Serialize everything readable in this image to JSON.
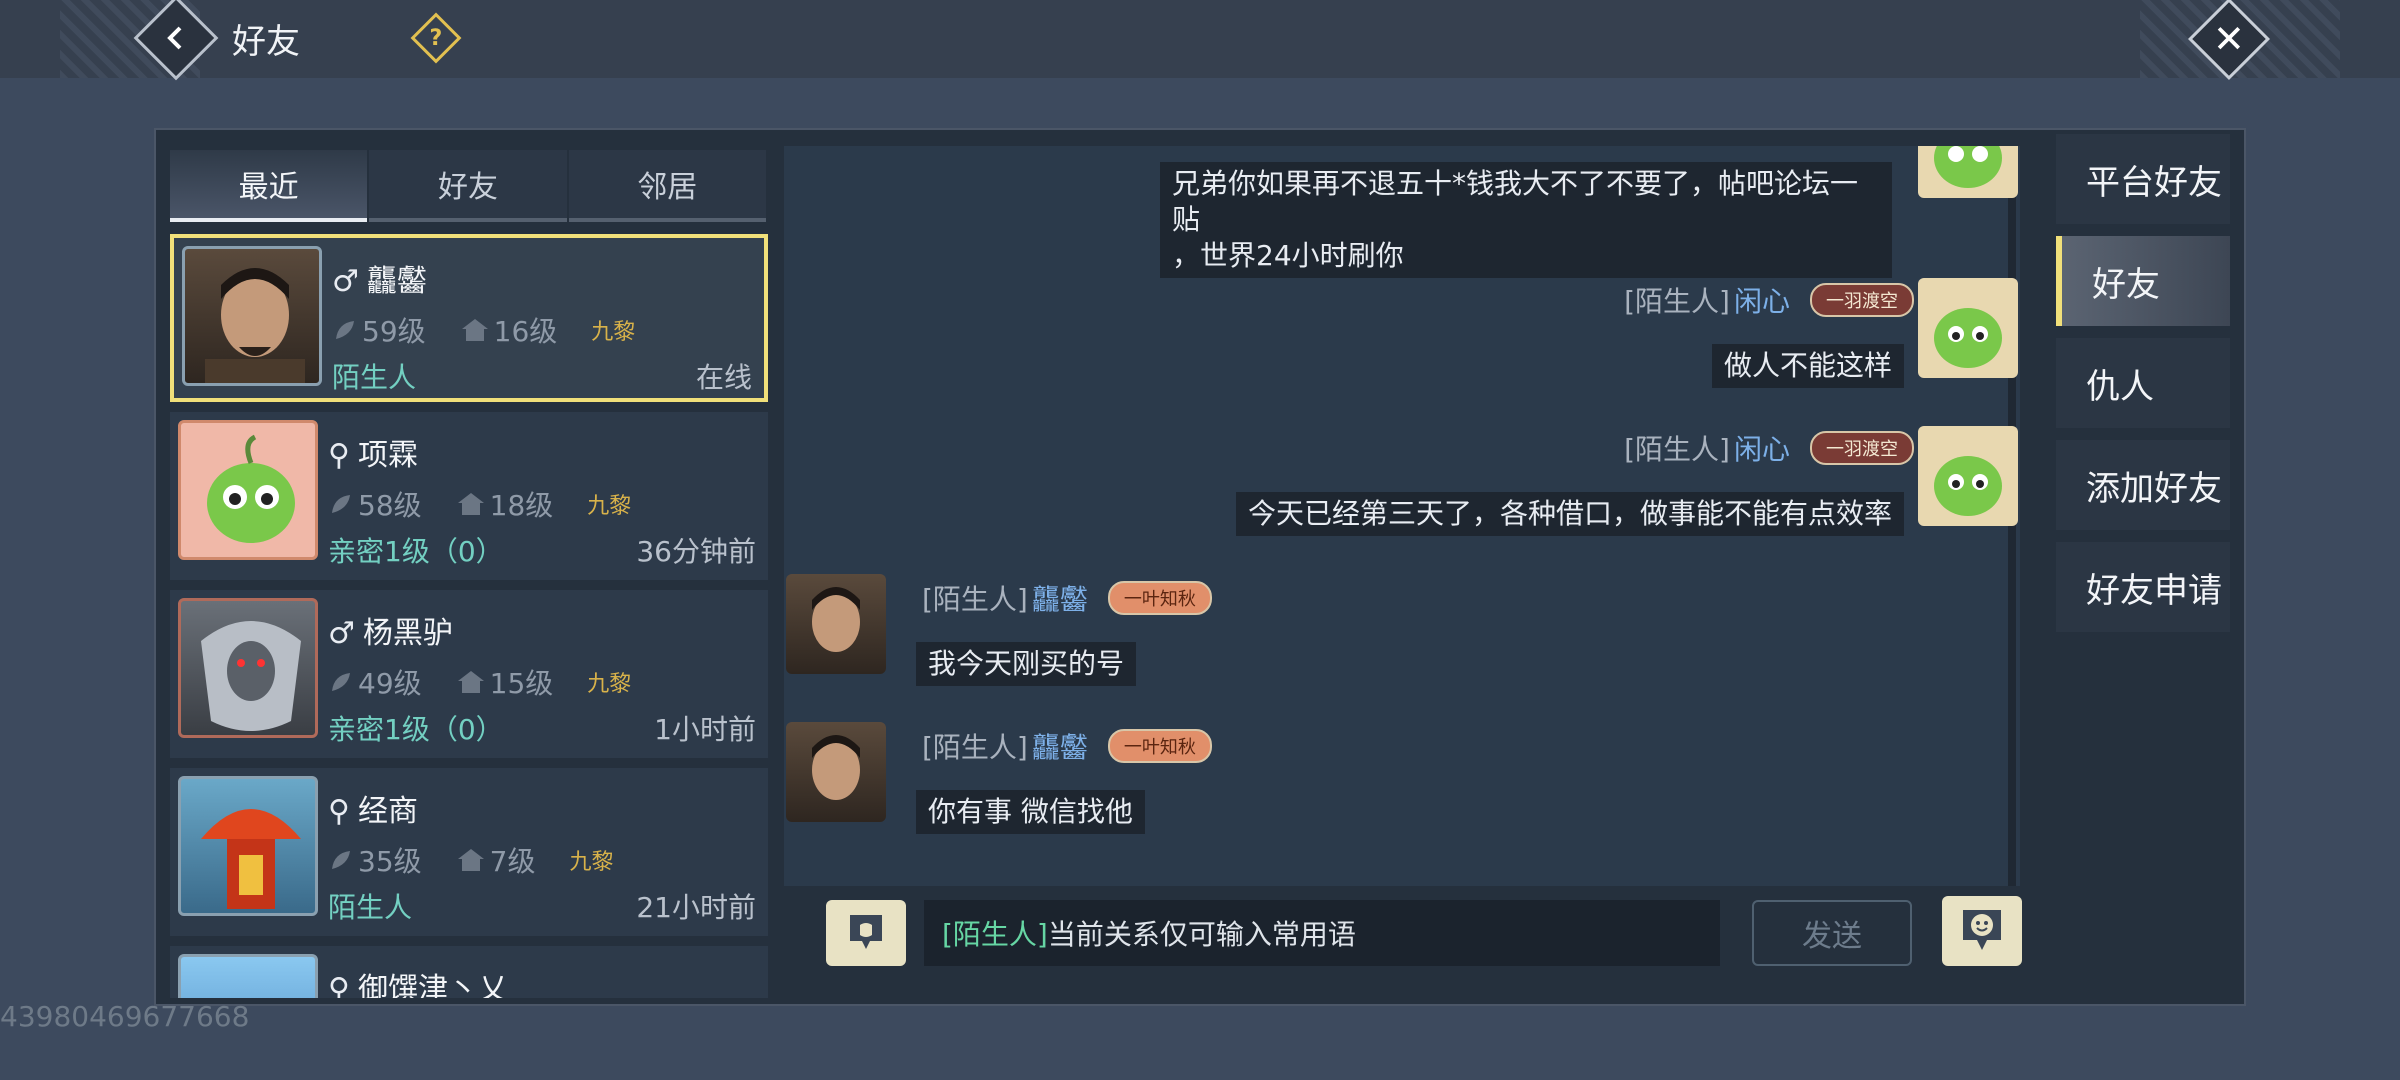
{
  "header": {
    "title": "好友",
    "help_label": "?",
    "close_label": "✕"
  },
  "tabs": [
    {
      "label": "最近",
      "active": true
    },
    {
      "label": "好友",
      "active": false
    },
    {
      "label": "邻居",
      "active": false
    }
  ],
  "friends": [
    {
      "name": "龘齾",
      "gender": "♂",
      "level": "59级",
      "guild_level": "16级",
      "server": "九黎",
      "relation": "陌生人",
      "time": "在线",
      "selected": true
    },
    {
      "name": "项霖",
      "gender": "⚲",
      "level": "58级",
      "guild_level": "18级",
      "server": "九黎",
      "relation": "亲密1级（0）",
      "time": "36分钟前"
    },
    {
      "name": "杨黑驴",
      "gender": "♂",
      "level": "49级",
      "guild_level": "15级",
      "server": "九黎",
      "relation": "亲密1级（0）",
      "time": "1小时前"
    },
    {
      "name": "经商",
      "gender": "⚲",
      "level": "35级",
      "guild_level": "7级",
      "server": "九黎",
      "relation": "陌生人",
      "time": "21小时前"
    },
    {
      "name": "御馔津丶乂",
      "gender": "⚲"
    }
  ],
  "messages": [
    {
      "side": "right",
      "text_line1": "兄弟你如果再不退五十*钱我大不了不要了，帖吧论坛一贴",
      "text_line2": "，世界24小时刷你"
    },
    {
      "side": "right",
      "tag": "[陌生人]",
      "name": "闲心",
      "badge": "一羽渡空",
      "text": "做人不能这样"
    },
    {
      "side": "right",
      "tag": "[陌生人]",
      "name": "闲心",
      "badge": "一羽渡空",
      "text": "今天已经第三天了，各种借口，做事能不能有点效率"
    },
    {
      "side": "left",
      "tag": "[陌生人]",
      "name": "龘齾",
      "badge": "一叶知秋",
      "text": "我今天刚买的号"
    },
    {
      "side": "left",
      "tag": "[陌生人]",
      "name": "龘齾",
      "badge": "一叶知秋",
      "text": "你有事 微信找他"
    }
  ],
  "input": {
    "tag": "[陌生人]",
    "text": "当前关系仅可输入常用语",
    "send_label": "发送"
  },
  "side_menu": [
    {
      "label": "平台好友",
      "active": false
    },
    {
      "label": "好友",
      "active": true
    },
    {
      "label": "仇人",
      "active": false
    },
    {
      "label": "添加好友",
      "active": false
    },
    {
      "label": "好友申请",
      "active": false
    }
  ],
  "uid": "43980469677668",
  "colors": {
    "accent_gold": "#f1e07a",
    "relation_teal": "#73d0c2",
    "name_blue": "#7db0e8"
  }
}
